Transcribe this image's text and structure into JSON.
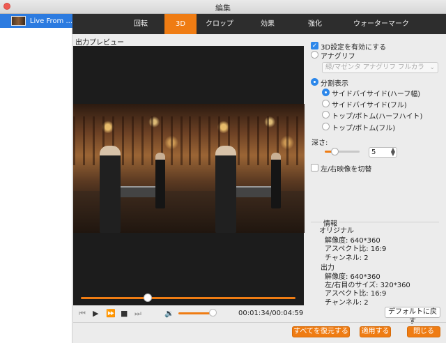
{
  "window": {
    "title": "編集"
  },
  "sidebar": {
    "file_name": "Live From ..."
  },
  "tabs": [
    "回転",
    "3D",
    "クロップ",
    "効果",
    "強化",
    "ウォーターマーク"
  ],
  "active_tab": "3D",
  "preview": {
    "label": "出力プレビュー",
    "seek_position": 0.31
  },
  "player": {
    "time": "00:01:34/00:04:59",
    "volume": 0.9,
    "prev_icon": "skip-back-icon",
    "play_icon": "play-icon",
    "fast_forward_icon": "fast-forward-icon",
    "stop_icon": "stop-icon",
    "next_icon": "skip-forward-icon",
    "volume_icon": "speaker-icon"
  },
  "settings3d": {
    "enable_label": "3D設定を有効にする",
    "enable_checked": true,
    "anaglyph_label": "アナグリフ",
    "anaglyph_select": "緑/マゼンタ アナグリフ フルカラ",
    "split_label": "分割表示",
    "split_options": [
      "サイドバイサイド(ハーフ幅)",
      "サイドバイサイド(フル)",
      "トップ/ボトム(ハーフハイト)",
      "トップ/ボトム(フル)"
    ],
    "selected_split": 0,
    "depth_label": "深さ:",
    "depth_value": "5",
    "swap_label": "左/右映像を切替",
    "swap_checked": false
  },
  "info": {
    "heading": "情報",
    "original_heading": "オリジナル",
    "original": [
      "解像度: 640*360",
      "アスペクト比: 16:9",
      "チャンネル: 2"
    ],
    "output_heading": "出力",
    "output": [
      "解像度: 640*360",
      "左/右目のサイズ: 320*360",
      "アスペクト比: 16:9",
      "チャンネル: 2"
    ]
  },
  "buttons": {
    "default": "デフォルトに戻す",
    "restore_all": "すべてを復元する",
    "apply": "適用する",
    "close": "閉じる"
  },
  "colors": {
    "accent": "#ef7c13",
    "selection": "#2c7be0",
    "tab_bar": "#2d2d2d"
  }
}
